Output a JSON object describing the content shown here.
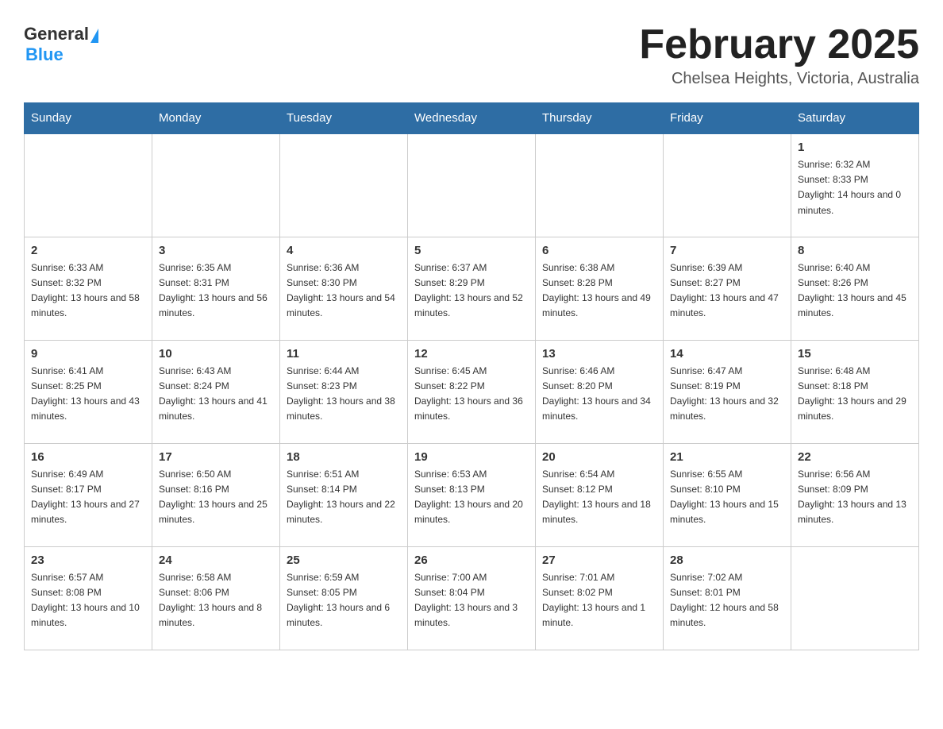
{
  "header": {
    "logo": {
      "general": "General",
      "blue": "Blue"
    },
    "title": "February 2025",
    "location": "Chelsea Heights, Victoria, Australia"
  },
  "calendar": {
    "days_of_week": [
      "Sunday",
      "Monday",
      "Tuesday",
      "Wednesday",
      "Thursday",
      "Friday",
      "Saturday"
    ],
    "weeks": [
      [
        {
          "day": "",
          "info": ""
        },
        {
          "day": "",
          "info": ""
        },
        {
          "day": "",
          "info": ""
        },
        {
          "day": "",
          "info": ""
        },
        {
          "day": "",
          "info": ""
        },
        {
          "day": "",
          "info": ""
        },
        {
          "day": "1",
          "info": "Sunrise: 6:32 AM\nSunset: 8:33 PM\nDaylight: 14 hours and 0 minutes."
        }
      ],
      [
        {
          "day": "2",
          "info": "Sunrise: 6:33 AM\nSunset: 8:32 PM\nDaylight: 13 hours and 58 minutes."
        },
        {
          "day": "3",
          "info": "Sunrise: 6:35 AM\nSunset: 8:31 PM\nDaylight: 13 hours and 56 minutes."
        },
        {
          "day": "4",
          "info": "Sunrise: 6:36 AM\nSunset: 8:30 PM\nDaylight: 13 hours and 54 minutes."
        },
        {
          "day": "5",
          "info": "Sunrise: 6:37 AM\nSunset: 8:29 PM\nDaylight: 13 hours and 52 minutes."
        },
        {
          "day": "6",
          "info": "Sunrise: 6:38 AM\nSunset: 8:28 PM\nDaylight: 13 hours and 49 minutes."
        },
        {
          "day": "7",
          "info": "Sunrise: 6:39 AM\nSunset: 8:27 PM\nDaylight: 13 hours and 47 minutes."
        },
        {
          "day": "8",
          "info": "Sunrise: 6:40 AM\nSunset: 8:26 PM\nDaylight: 13 hours and 45 minutes."
        }
      ],
      [
        {
          "day": "9",
          "info": "Sunrise: 6:41 AM\nSunset: 8:25 PM\nDaylight: 13 hours and 43 minutes."
        },
        {
          "day": "10",
          "info": "Sunrise: 6:43 AM\nSunset: 8:24 PM\nDaylight: 13 hours and 41 minutes."
        },
        {
          "day": "11",
          "info": "Sunrise: 6:44 AM\nSunset: 8:23 PM\nDaylight: 13 hours and 38 minutes."
        },
        {
          "day": "12",
          "info": "Sunrise: 6:45 AM\nSunset: 8:22 PM\nDaylight: 13 hours and 36 minutes."
        },
        {
          "day": "13",
          "info": "Sunrise: 6:46 AM\nSunset: 8:20 PM\nDaylight: 13 hours and 34 minutes."
        },
        {
          "day": "14",
          "info": "Sunrise: 6:47 AM\nSunset: 8:19 PM\nDaylight: 13 hours and 32 minutes."
        },
        {
          "day": "15",
          "info": "Sunrise: 6:48 AM\nSunset: 8:18 PM\nDaylight: 13 hours and 29 minutes."
        }
      ],
      [
        {
          "day": "16",
          "info": "Sunrise: 6:49 AM\nSunset: 8:17 PM\nDaylight: 13 hours and 27 minutes."
        },
        {
          "day": "17",
          "info": "Sunrise: 6:50 AM\nSunset: 8:16 PM\nDaylight: 13 hours and 25 minutes."
        },
        {
          "day": "18",
          "info": "Sunrise: 6:51 AM\nSunset: 8:14 PM\nDaylight: 13 hours and 22 minutes."
        },
        {
          "day": "19",
          "info": "Sunrise: 6:53 AM\nSunset: 8:13 PM\nDaylight: 13 hours and 20 minutes."
        },
        {
          "day": "20",
          "info": "Sunrise: 6:54 AM\nSunset: 8:12 PM\nDaylight: 13 hours and 18 minutes."
        },
        {
          "day": "21",
          "info": "Sunrise: 6:55 AM\nSunset: 8:10 PM\nDaylight: 13 hours and 15 minutes."
        },
        {
          "day": "22",
          "info": "Sunrise: 6:56 AM\nSunset: 8:09 PM\nDaylight: 13 hours and 13 minutes."
        }
      ],
      [
        {
          "day": "23",
          "info": "Sunrise: 6:57 AM\nSunset: 8:08 PM\nDaylight: 13 hours and 10 minutes."
        },
        {
          "day": "24",
          "info": "Sunrise: 6:58 AM\nSunset: 8:06 PM\nDaylight: 13 hours and 8 minutes."
        },
        {
          "day": "25",
          "info": "Sunrise: 6:59 AM\nSunset: 8:05 PM\nDaylight: 13 hours and 6 minutes."
        },
        {
          "day": "26",
          "info": "Sunrise: 7:00 AM\nSunset: 8:04 PM\nDaylight: 13 hours and 3 minutes."
        },
        {
          "day": "27",
          "info": "Sunrise: 7:01 AM\nSunset: 8:02 PM\nDaylight: 13 hours and 1 minute."
        },
        {
          "day": "28",
          "info": "Sunrise: 7:02 AM\nSunset: 8:01 PM\nDaylight: 12 hours and 58 minutes."
        },
        {
          "day": "",
          "info": ""
        }
      ]
    ]
  }
}
